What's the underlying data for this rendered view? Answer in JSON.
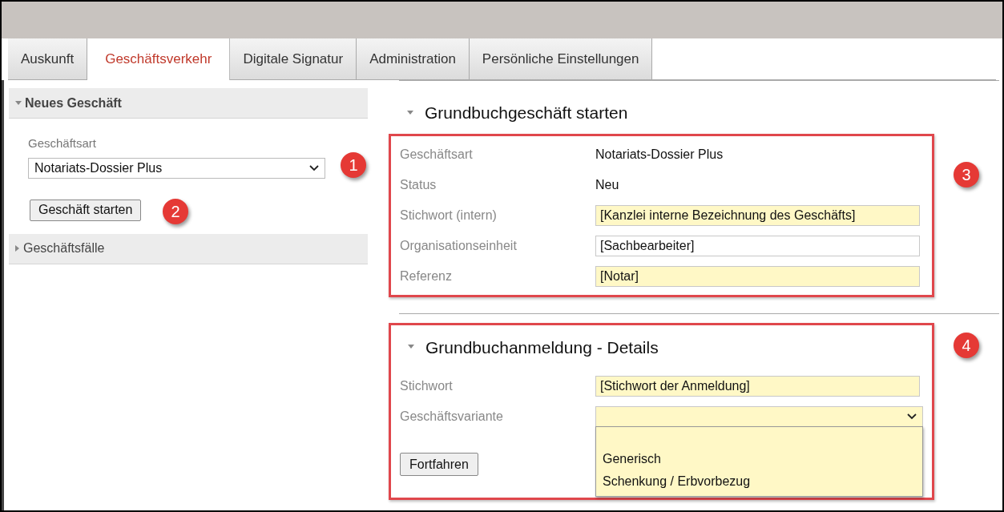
{
  "tabs": [
    {
      "label": "Auskunft",
      "selected": false
    },
    {
      "label": "Geschäftsverkehr",
      "selected": true
    },
    {
      "label": "Digitale Signatur",
      "selected": false
    },
    {
      "label": "Administration",
      "selected": false
    },
    {
      "label": "Persönliche Einstellungen",
      "selected": false
    }
  ],
  "sidebar": {
    "sections": [
      {
        "title": "Neues Geschäft",
        "expanded": true,
        "field_label": "Geschäftsart",
        "select_value": "Notariats-Dossier Plus",
        "select_badge": "1",
        "button": "Geschäft starten",
        "button_badge": "2"
      },
      {
        "title": "Geschäftsfälle",
        "expanded": false
      }
    ]
  },
  "start_section": {
    "title": "Grundbuchgeschäft starten",
    "expanded": true,
    "badge": "3",
    "rows": [
      {
        "label": "Geschäftsart",
        "kind": "text",
        "value": "Notariats-Dossier Plus"
      },
      {
        "label": "Status",
        "kind": "text",
        "value": "Neu"
      },
      {
        "label": "Stichwort (intern)",
        "kind": "input",
        "value": "[Kanzlei interne Bezeichnung des Geschäfts]",
        "required": true
      },
      {
        "label": "Organisationseinheit",
        "kind": "input",
        "value": "[Sachbearbeiter]",
        "required": false
      },
      {
        "label": "Referenz",
        "kind": "input",
        "value": "[Notar]",
        "required": true
      }
    ]
  },
  "details_section": {
    "title": "Grundbuchanmeldung - Details",
    "expanded": true,
    "badge": "4",
    "stichwort": {
      "label": "Stichwort",
      "value": "[Stichwort der Anmeldung]"
    },
    "variante": {
      "label": "Geschäftsvariante",
      "expanded": true,
      "options": [
        "Generisch",
        "Schenkung / Erbvorbezug"
      ]
    },
    "button": "Fortfahren"
  }
}
